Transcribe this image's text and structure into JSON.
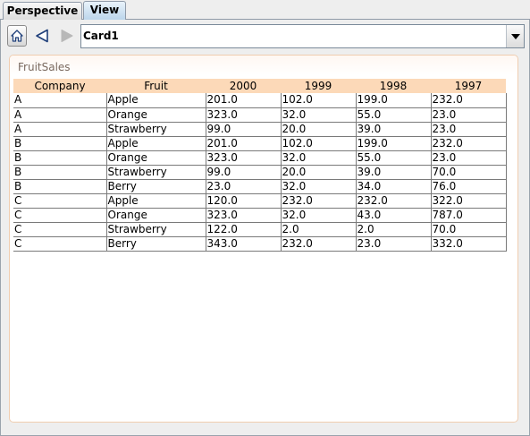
{
  "tabs": [
    {
      "label": "Perspective",
      "active": false
    },
    {
      "label": "View",
      "active": true
    }
  ],
  "toolbar": {
    "icons": [
      "home-icon",
      "back-arrow-icon",
      "forward-arrow-icon"
    ],
    "combo_value": "Card1"
  },
  "panel": {
    "title": "FruitSales"
  },
  "table": {
    "columns": [
      "Company",
      "Fruit",
      "2000",
      "1999",
      "1998",
      "1997"
    ],
    "rows": [
      [
        "A",
        "Apple",
        "201.0",
        "102.0",
        "199.0",
        "232.0"
      ],
      [
        "A",
        "Orange",
        "323.0",
        "32.0",
        "55.0",
        "23.0"
      ],
      [
        "A",
        "Strawberry",
        "99.0",
        "20.0",
        "39.0",
        "23.0"
      ],
      [
        "B",
        "Apple",
        "201.0",
        "102.0",
        "199.0",
        "232.0"
      ],
      [
        "B",
        "Orange",
        "323.0",
        "32.0",
        "55.0",
        "23.0"
      ],
      [
        "B",
        "Strawberry",
        "99.0",
        "20.0",
        "39.0",
        "70.0"
      ],
      [
        "B",
        "Berry",
        "23.0",
        "32.0",
        "34.0",
        "76.0"
      ],
      [
        "C",
        "Apple",
        "120.0",
        "232.0",
        "232.0",
        "322.0"
      ],
      [
        "C",
        "Orange",
        "323.0",
        "32.0",
        "43.0",
        "787.0"
      ],
      [
        "C",
        "Strawberry",
        "122.0",
        "2.0",
        "2.0",
        "70.0"
      ],
      [
        "C",
        "Berry",
        "343.0",
        "232.0",
        "23.0",
        "332.0"
      ]
    ]
  },
  "colors": {
    "header_bg": "#fcd9b8",
    "panel_border": "#f0cdb0",
    "panel_title_text": "#7a6a60",
    "active_tab": "#b9d4ea"
  }
}
